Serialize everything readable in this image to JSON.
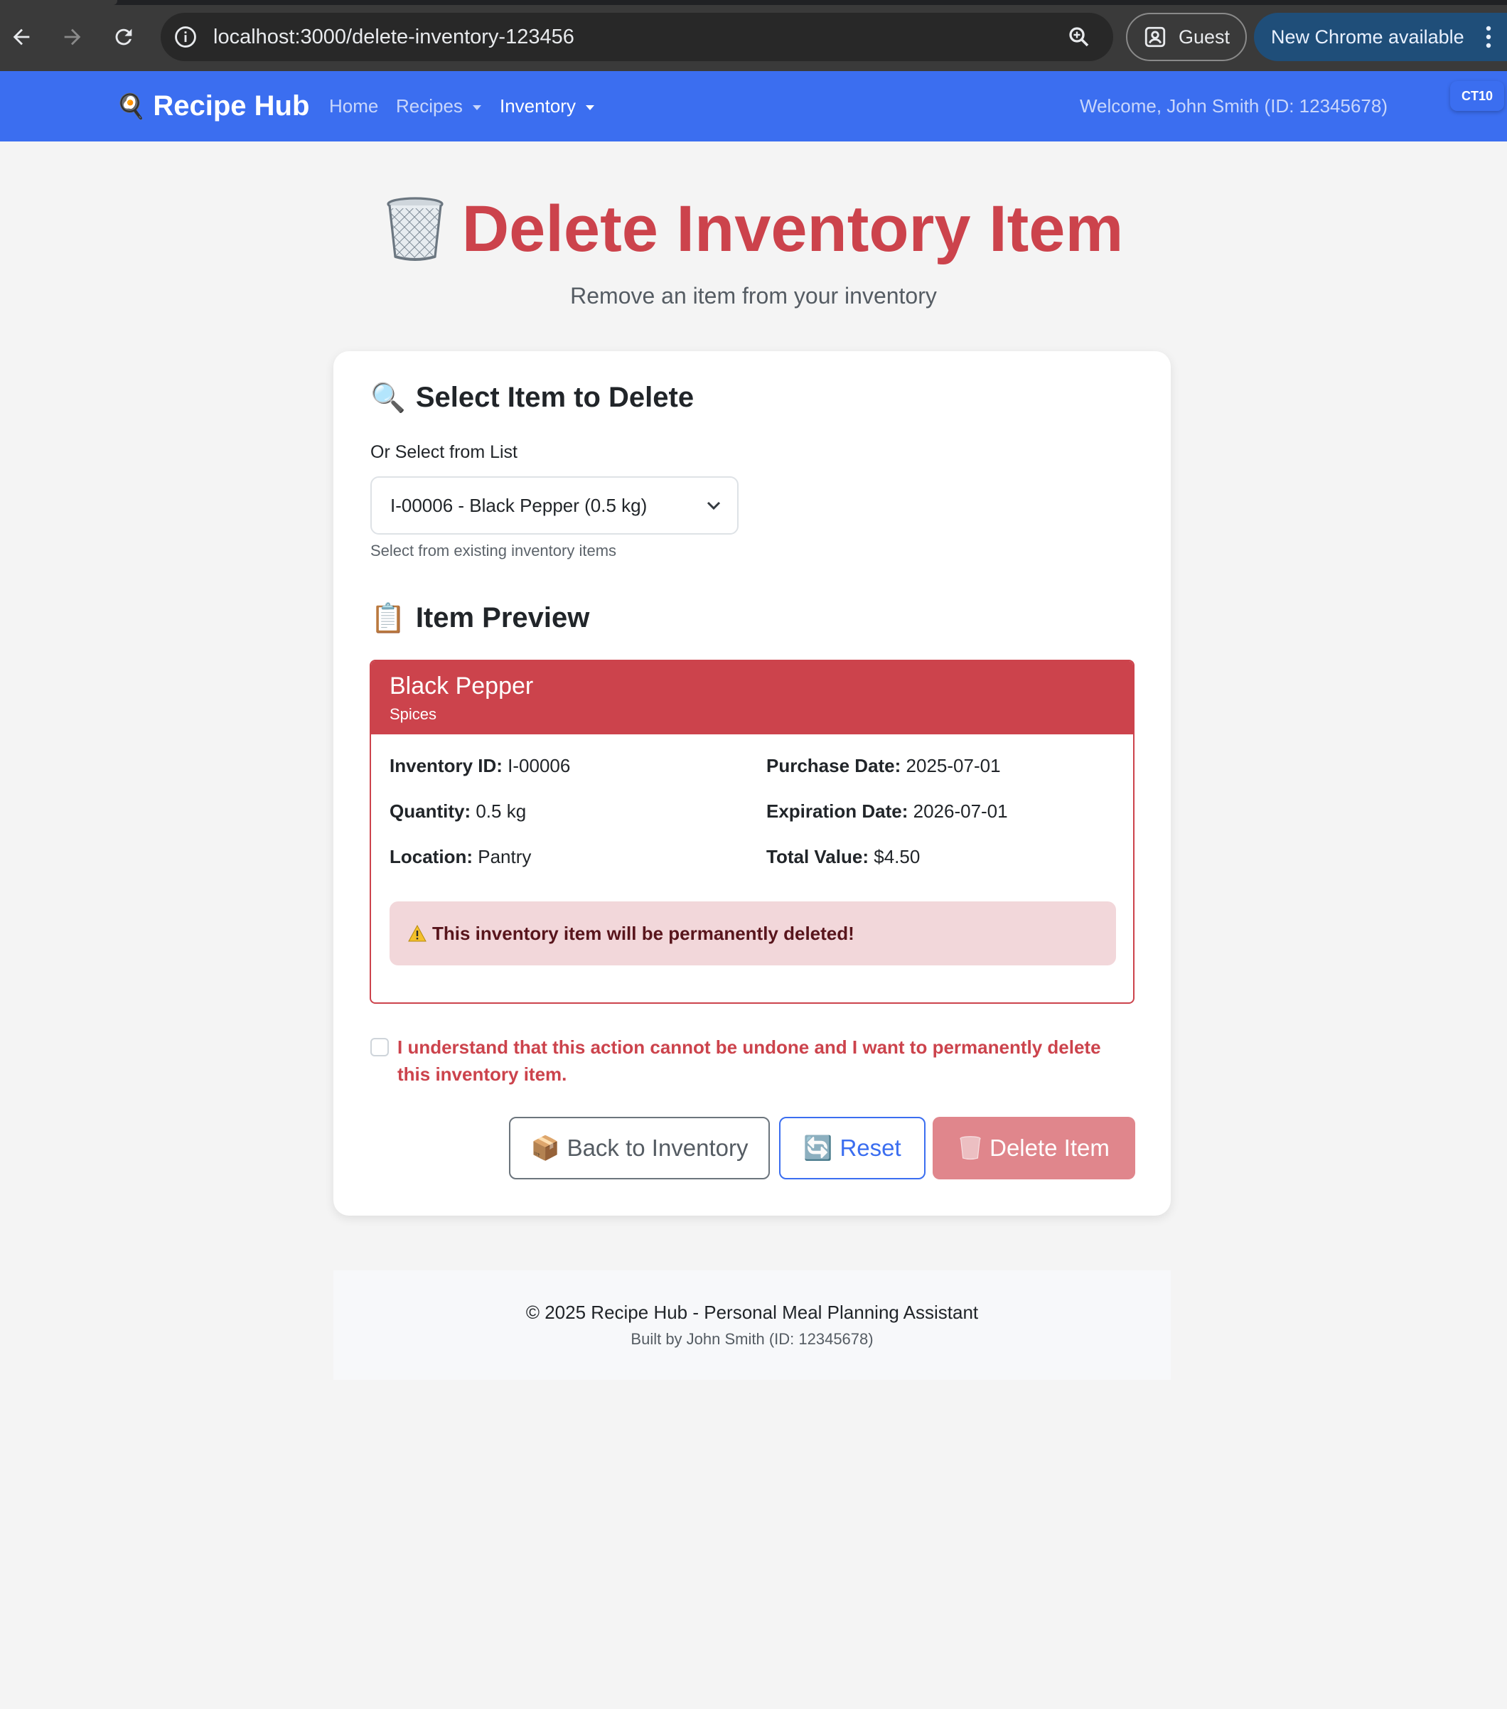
{
  "browser": {
    "url": "localhost:3000/delete-inventory-123456",
    "profile_label": "Guest",
    "update_label": "New Chrome available"
  },
  "navbar": {
    "brand": "Recipe Hub",
    "links": {
      "home": "Home",
      "recipes": "Recipes",
      "inventory": "Inventory"
    },
    "welcome": "Welcome, John Smith (ID: 12345678)",
    "badge": "CT10"
  },
  "header": {
    "title": "Delete Inventory Item",
    "subtitle": "Remove an item from your inventory"
  },
  "select_section": {
    "title": "Select Item to Delete",
    "label": "Or Select from List",
    "selected_value": "I-00006 - Black Pepper (0.5 kg)",
    "help": "Select from existing inventory items"
  },
  "preview": {
    "title": "Item Preview",
    "name": "Black Pepper",
    "category": "Spices",
    "fields": {
      "inventory_id": {
        "label": "Inventory ID:",
        "value": "I-00006"
      },
      "quantity": {
        "label": "Quantity:",
        "value": "0.5 kg"
      },
      "location": {
        "label": "Location:",
        "value": "Pantry"
      },
      "purchase_date": {
        "label": "Purchase Date:",
        "value": "2025-07-01"
      },
      "expiration_date": {
        "label": "Expiration Date:",
        "value": "2026-07-01"
      },
      "total_value": {
        "label": "Total Value:",
        "value": "$4.50"
      }
    },
    "warning": "This inventory item will be permanently deleted!"
  },
  "confirm": {
    "text": "I understand that this action cannot be undone and I want to permanently delete this inventory item.",
    "checked": false
  },
  "actions": {
    "back": "Back to Inventory",
    "reset": "Reset",
    "delete": "Delete Item"
  },
  "footer": {
    "main": "© 2025 Recipe Hub - Personal Meal Planning Assistant",
    "sub": "Built by John Smith (ID: 12345678)"
  },
  "colors": {
    "navbar": "#3b6ef0",
    "danger": "#cc434c",
    "danger_disabled": "#e0868c",
    "warning_bg": "#f2d7da"
  }
}
